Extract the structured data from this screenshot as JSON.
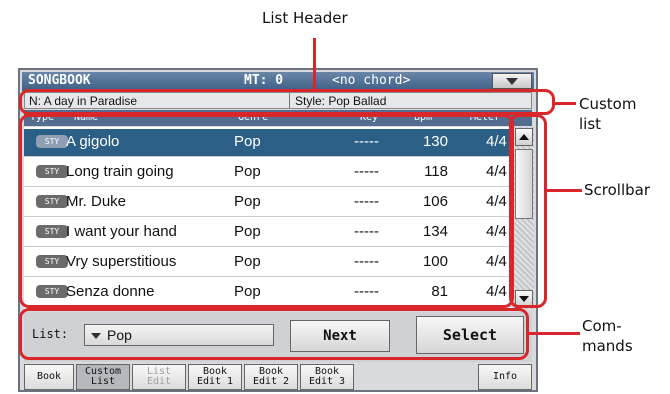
{
  "callouts": {
    "list_header": "List Header",
    "custom_list": "Custom\nlist",
    "scrollbar": "Scrollbar",
    "commands": "Com-\nmands"
  },
  "topbar": {
    "title": "SONGBOOK",
    "mt": "MT: 0",
    "chord": "<no chord>"
  },
  "info": {
    "song": "N: A day in Paradise",
    "style": "Style: Pop Ballad"
  },
  "columns": [
    "Type",
    "Name",
    "Genre",
    "Key",
    "Bpm",
    "Meter"
  ],
  "rows": [
    {
      "type": "STY",
      "name": "A gigolo",
      "genre": "Pop",
      "key": "-----",
      "bpm": "130",
      "meter": "4/4"
    },
    {
      "type": "STY",
      "name": "Long train going",
      "genre": "Pop",
      "key": "-----",
      "bpm": "118",
      "meter": "4/4"
    },
    {
      "type": "STY",
      "name": "Mr. Duke",
      "genre": "Pop",
      "key": "-----",
      "bpm": "106",
      "meter": "4/4"
    },
    {
      "type": "STY",
      "name": "I want your hand",
      "genre": "Pop",
      "key": "-----",
      "bpm": "134",
      "meter": "4/4"
    },
    {
      "type": "STY",
      "name": "Vry superstitious",
      "genre": "Pop",
      "key": "-----",
      "bpm": "100",
      "meter": "4/4"
    },
    {
      "type": "STY",
      "name": "Senza donne",
      "genre": "Pop",
      "key": "-----",
      "bpm": "81",
      "meter": "4/4"
    }
  ],
  "commands": {
    "list_label": "List:",
    "list_value": "Pop",
    "next": "Next",
    "select": "Select"
  },
  "tabs": [
    "Book",
    "Custom\nList",
    "List\nEdit",
    "Book\nEdit 1",
    "Book\nEdit 2",
    "Book\nEdit 3",
    "Info"
  ],
  "colors": {
    "callout_red": "#d8262a",
    "selected_row": "#2c5f86",
    "title_bar": "#4a6a90"
  }
}
